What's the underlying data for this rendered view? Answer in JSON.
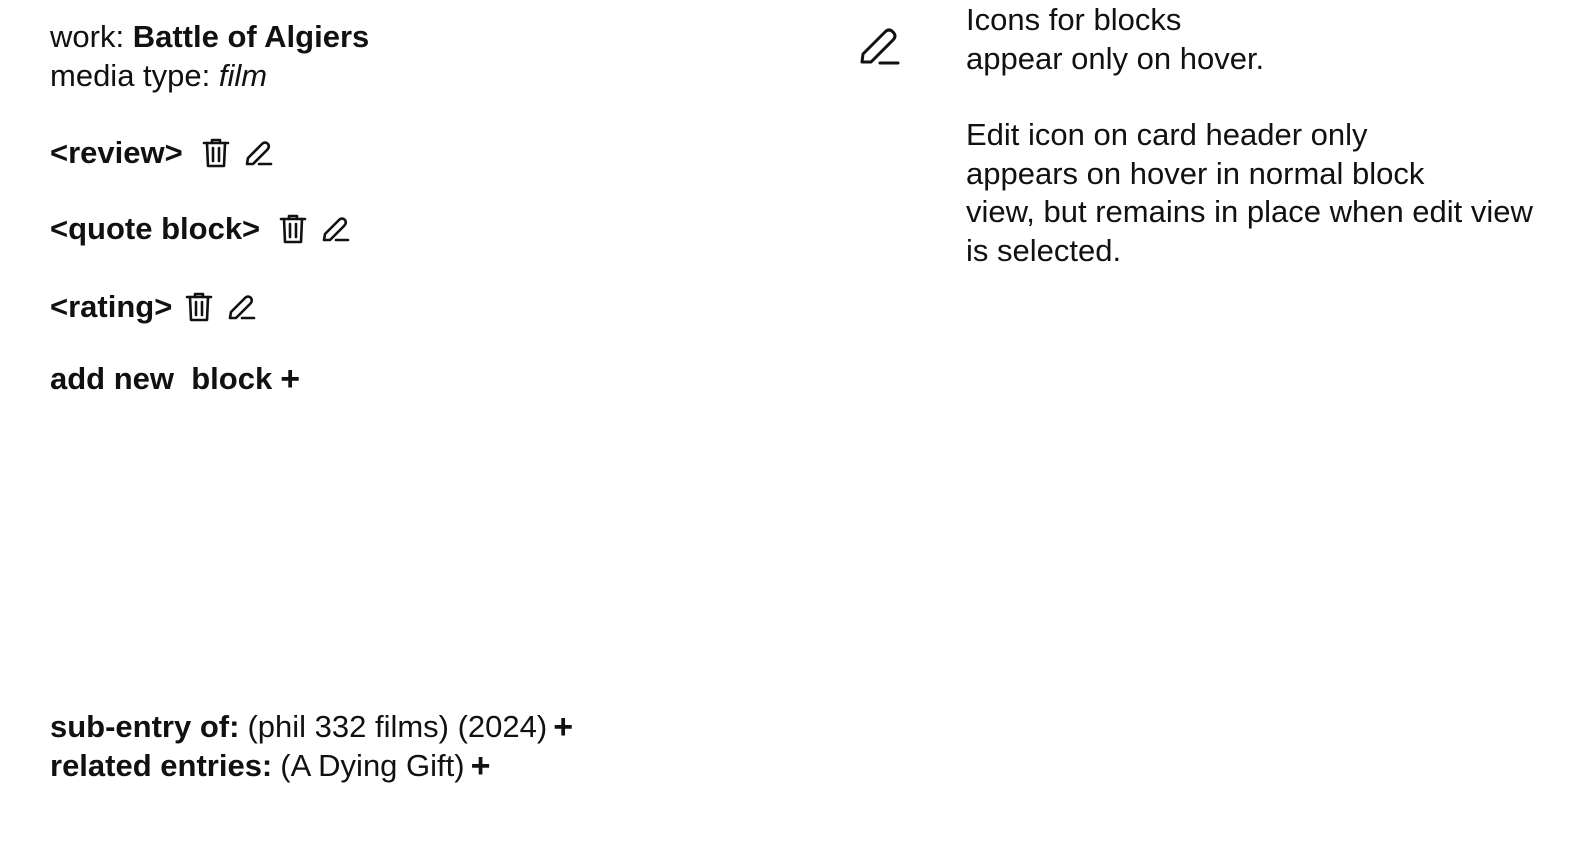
{
  "header": {
    "work_label": "work:",
    "work_title": "Battle of Algiers",
    "media_label": "media type:",
    "media_value": "film"
  },
  "blocks": [
    {
      "label": "<review>"
    },
    {
      "label": "<quote block>"
    },
    {
      "label": "<rating>"
    }
  ],
  "add_block": {
    "label": "add new  block",
    "plus": "+"
  },
  "footer": {
    "subentry_label": "sub-entry of:",
    "subentry_value": "(phil 332 films) (2024)",
    "subentry_plus": "+",
    "related_label": "related entries:",
    "related_value": "(A Dying Gift)",
    "related_plus": "+"
  },
  "notes": {
    "note1": "Icons for blocks\nappear only on hover.",
    "note2": "Edit icon on card header only\nappears on hover in normal block\nview, but remains in place when edit view\nis selected."
  },
  "icons": {
    "delete": "trash-icon",
    "edit": "pencil-icon"
  },
  "colors": {
    "text": "#111111",
    "background": "#ffffff"
  }
}
